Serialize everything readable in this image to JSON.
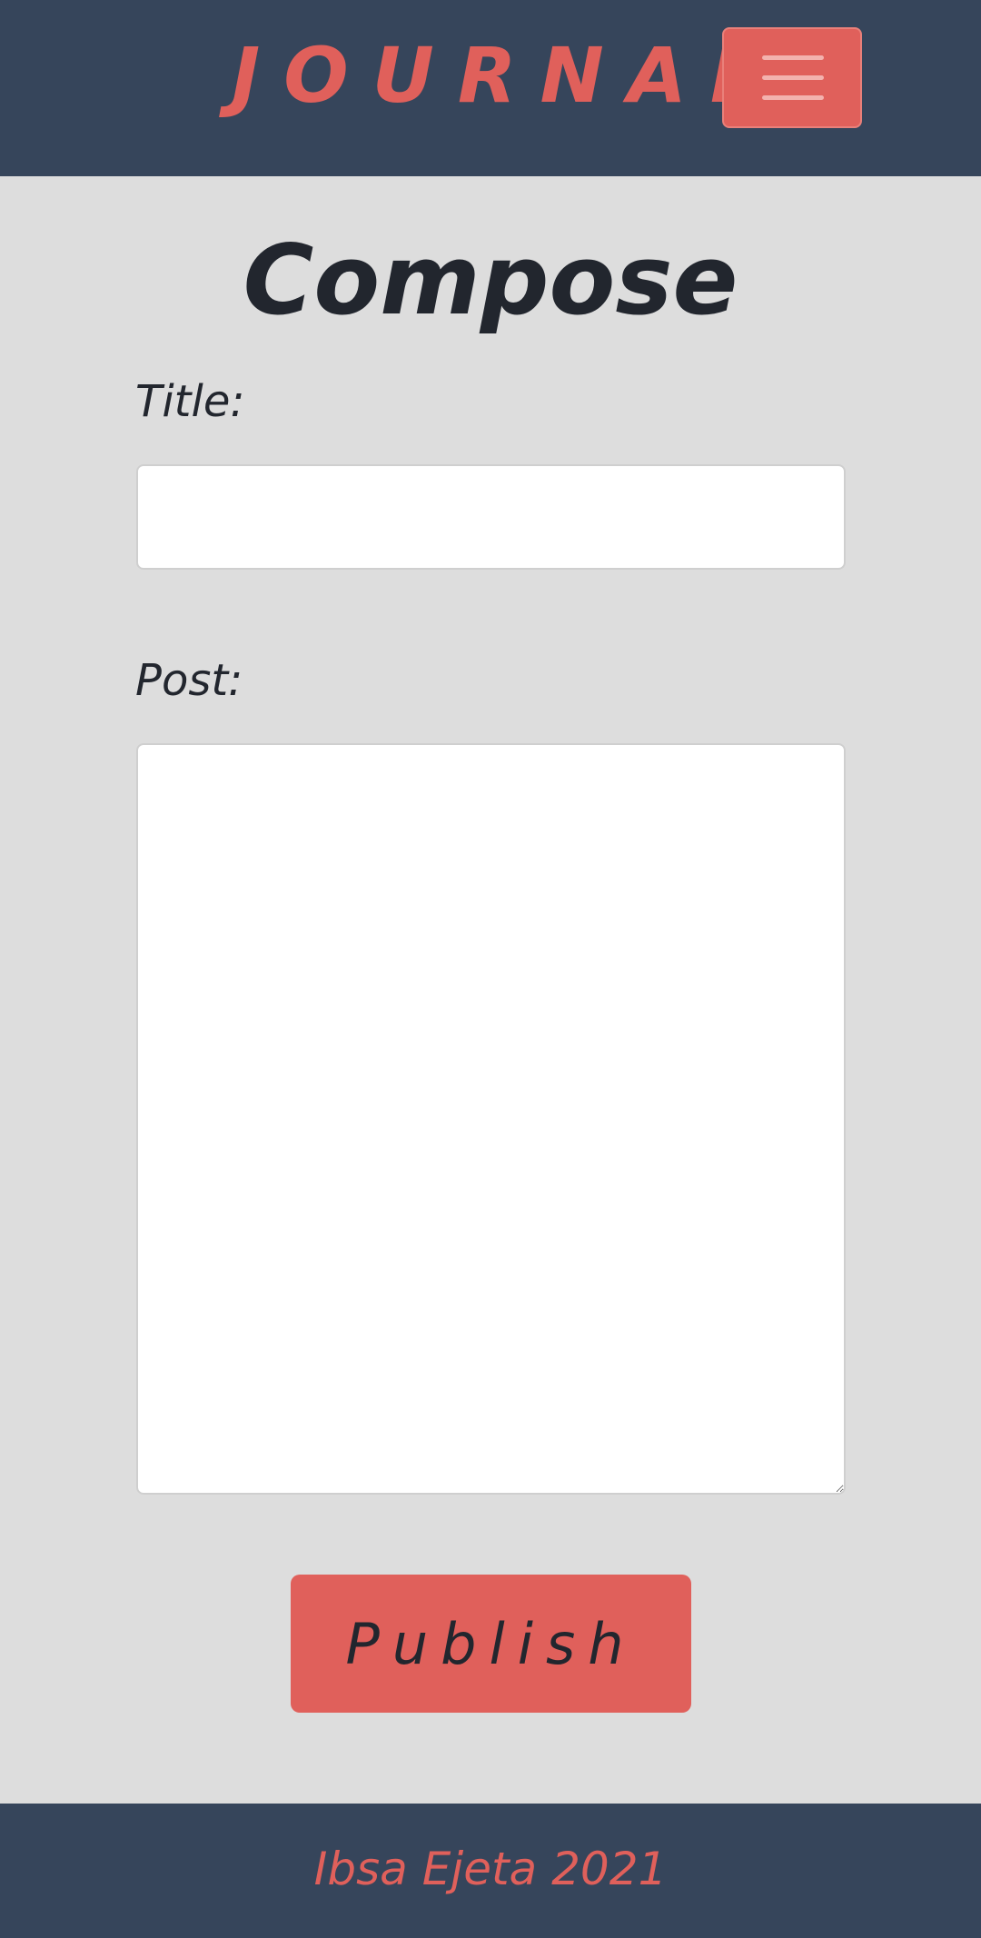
{
  "navbar": {
    "brand": "JOURNAL",
    "menu_icon": "hamburger-menu-icon",
    "colors": {
      "background": "#36455b",
      "accent": "#e0605b"
    }
  },
  "compose": {
    "heading": "Compose",
    "title_label": "Title:",
    "title_value": "",
    "post_label": "Post:",
    "post_value": "",
    "publish_label": "Publish"
  },
  "footer": {
    "text": "Ibsa Ejeta 2021"
  }
}
